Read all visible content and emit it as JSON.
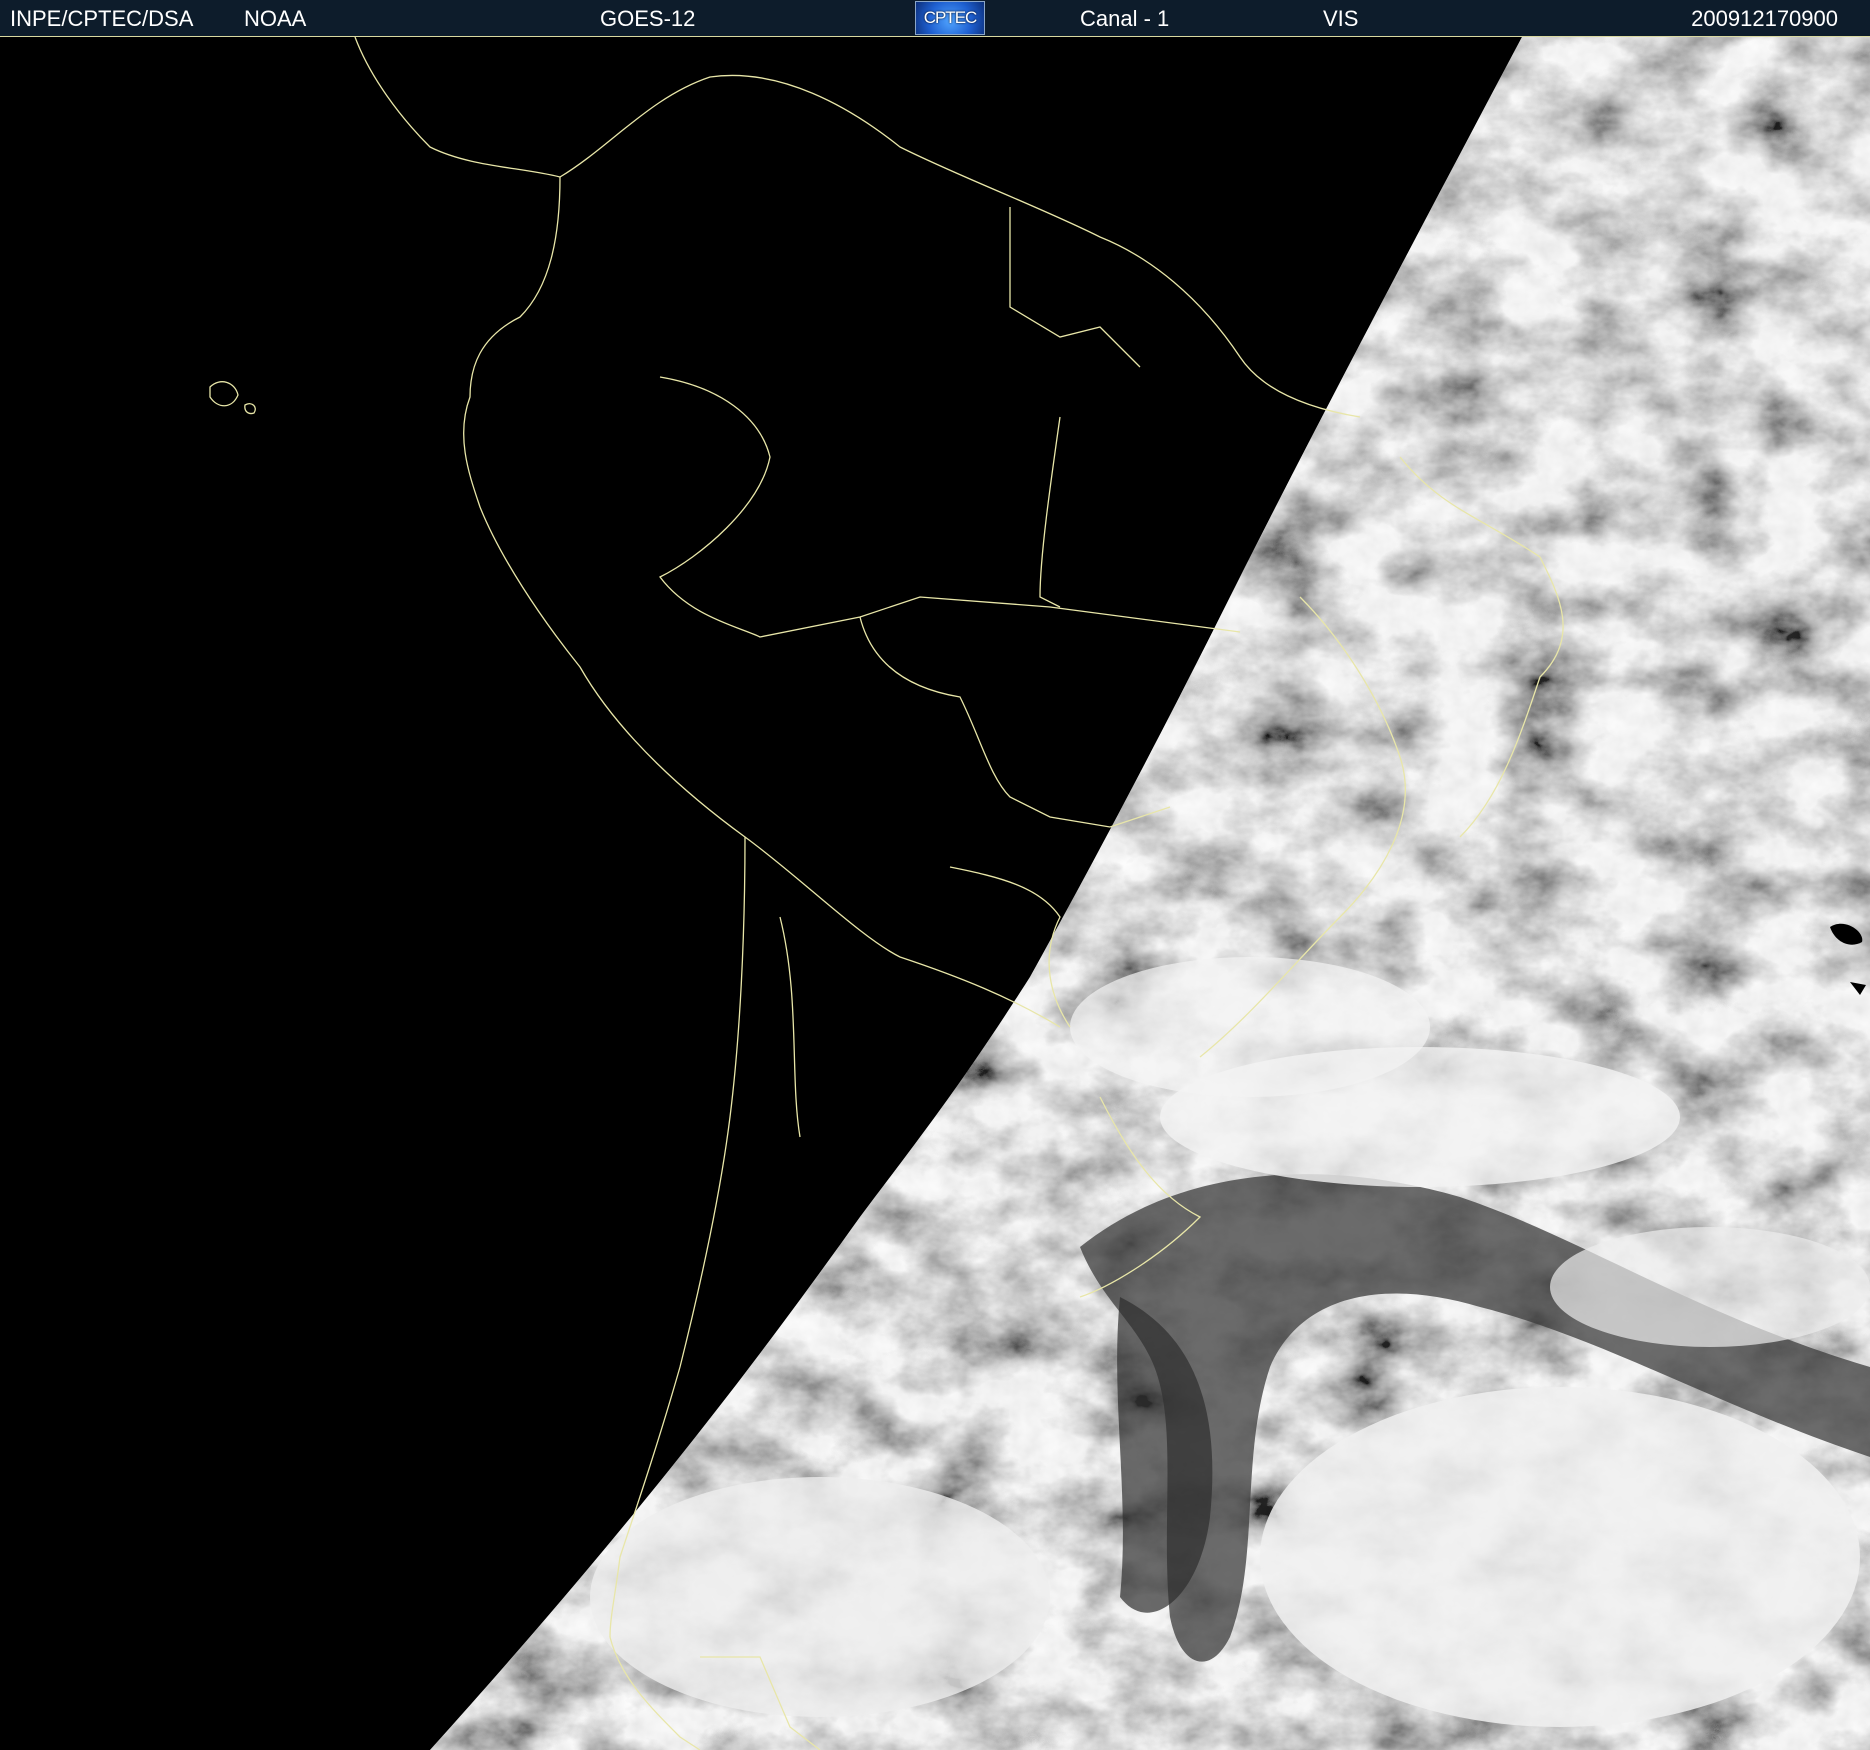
{
  "header": {
    "agency": "INPE/CPTEC/DSA",
    "provider": "NOAA",
    "satellite": "GOES-12",
    "logo_text": "CPTEC",
    "channel": "Canal - 1",
    "band": "VIS",
    "timestamp": "200912170900"
  },
  "image": {
    "description_icon": "satellite-visible-image",
    "night_side_color": "#000000",
    "border_line_color": "#e8e6a8",
    "header_color": "#0d1c2b"
  }
}
